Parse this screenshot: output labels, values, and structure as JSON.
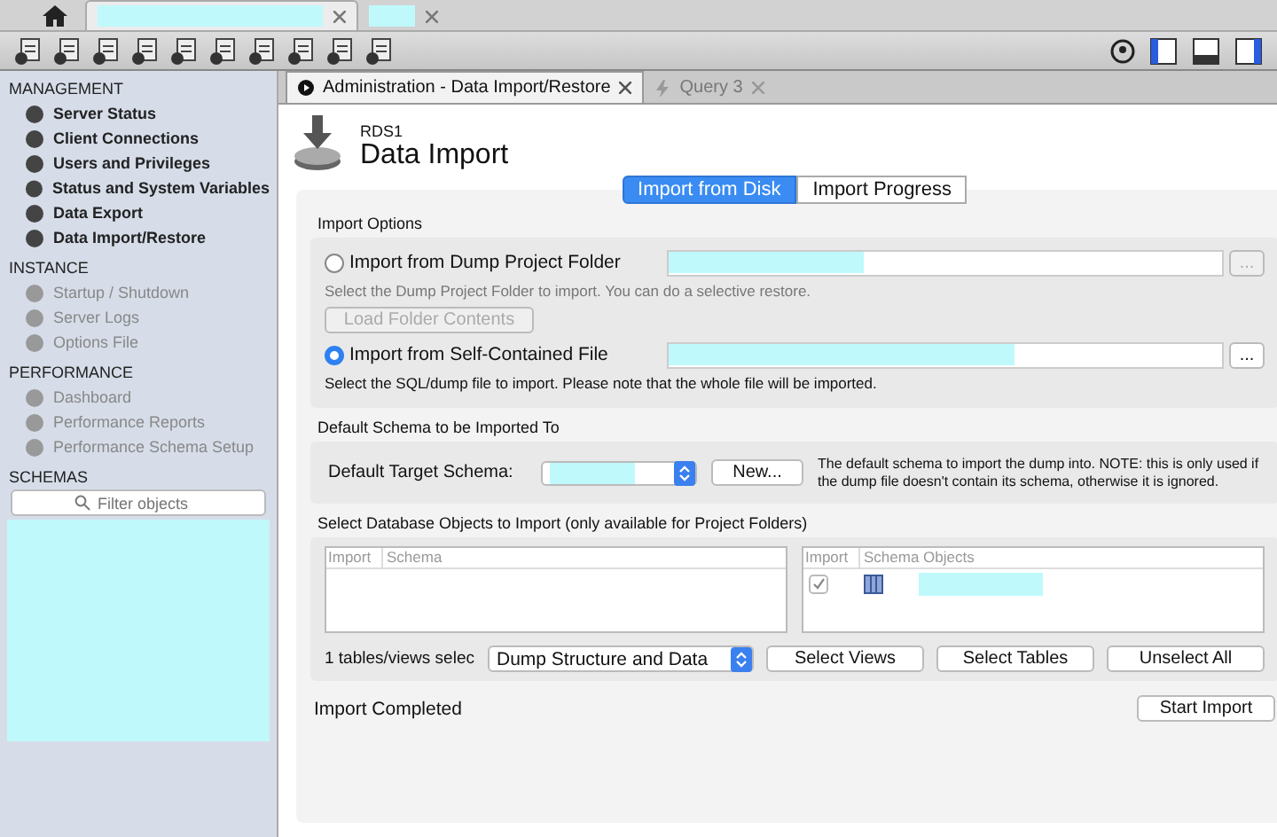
{
  "top_tabs": [
    {
      "kind": "home",
      "selected": false
    },
    {
      "kind": "connection",
      "selected": true
    },
    {
      "kind": "connection",
      "selected": false
    }
  ],
  "sidebar": {
    "sections": [
      {
        "title": "MANAGEMENT",
        "items": [
          {
            "label": "Server Status",
            "disabled": false
          },
          {
            "label": "Client Connections",
            "disabled": false
          },
          {
            "label": "Users and Privileges",
            "disabled": false
          },
          {
            "label": "Status and System Variables",
            "disabled": false
          },
          {
            "label": "Data Export",
            "disabled": false
          },
          {
            "label": "Data Import/Restore",
            "disabled": false
          }
        ]
      },
      {
        "title": "INSTANCE",
        "items": [
          {
            "label": "Startup / Shutdown",
            "disabled": true
          },
          {
            "label": "Server Logs",
            "disabled": true
          },
          {
            "label": "Options File",
            "disabled": true
          }
        ]
      },
      {
        "title": "PERFORMANCE",
        "items": [
          {
            "label": "Dashboard",
            "disabled": true
          },
          {
            "label": "Performance Reports",
            "disabled": true
          },
          {
            "label": "Performance Schema Setup",
            "disabled": true
          }
        ]
      }
    ],
    "schemas": {
      "title": "SCHEMAS",
      "placeholder": "Filter objects"
    }
  },
  "editor_tabs": [
    {
      "kind": "admin",
      "label": "Administration - Data Import/Restore",
      "selected": true
    },
    {
      "kind": "query",
      "label": "Query 3",
      "selected": false
    }
  ],
  "header": {
    "connection": "RDS1",
    "title": "Data Import"
  },
  "view_tabs": [
    {
      "label": "Import from Disk",
      "selected": true
    },
    {
      "label": "Import Progress",
      "selected": false
    }
  ],
  "import_options": {
    "title": "Import Options",
    "options": [
      {
        "label": "Import from Dump Project Folder",
        "selected": false,
        "hint": "Select the Dump Project Folder to import. You can do a selective restore.",
        "browse": "...",
        "disabled": true,
        "load_button": "Load Folder Contents"
      },
      {
        "label": "Import from Self-Contained File",
        "selected": true,
        "hint": "Select the SQL/dump file to import. Please note that the whole file will be imported.",
        "browse": "...",
        "disabled": false
      }
    ]
  },
  "default_schema": {
    "title": "Default Schema to be Imported To",
    "label": "Default Target Schema:",
    "new_button": "New...",
    "note": "The default schema to import the dump into. NOTE: this is only used if the dump file doesn't contain its schema, otherwise it is ignored."
  },
  "objects": {
    "title": "Select Database Objects to Import (only available for Project Folders)",
    "schema_columns": [
      "Import",
      "Schema"
    ],
    "object_columns": [
      "Import",
      "Schema Objects"
    ],
    "object_rows": [
      {
        "checked": true
      }
    ],
    "count": "1 tables/views selec",
    "dump_select": "Dump Structure and Data",
    "buttons": [
      "Select Views",
      "Select Tables",
      "Unselect All"
    ]
  },
  "status": "Import Completed",
  "start_button": "Start Import"
}
